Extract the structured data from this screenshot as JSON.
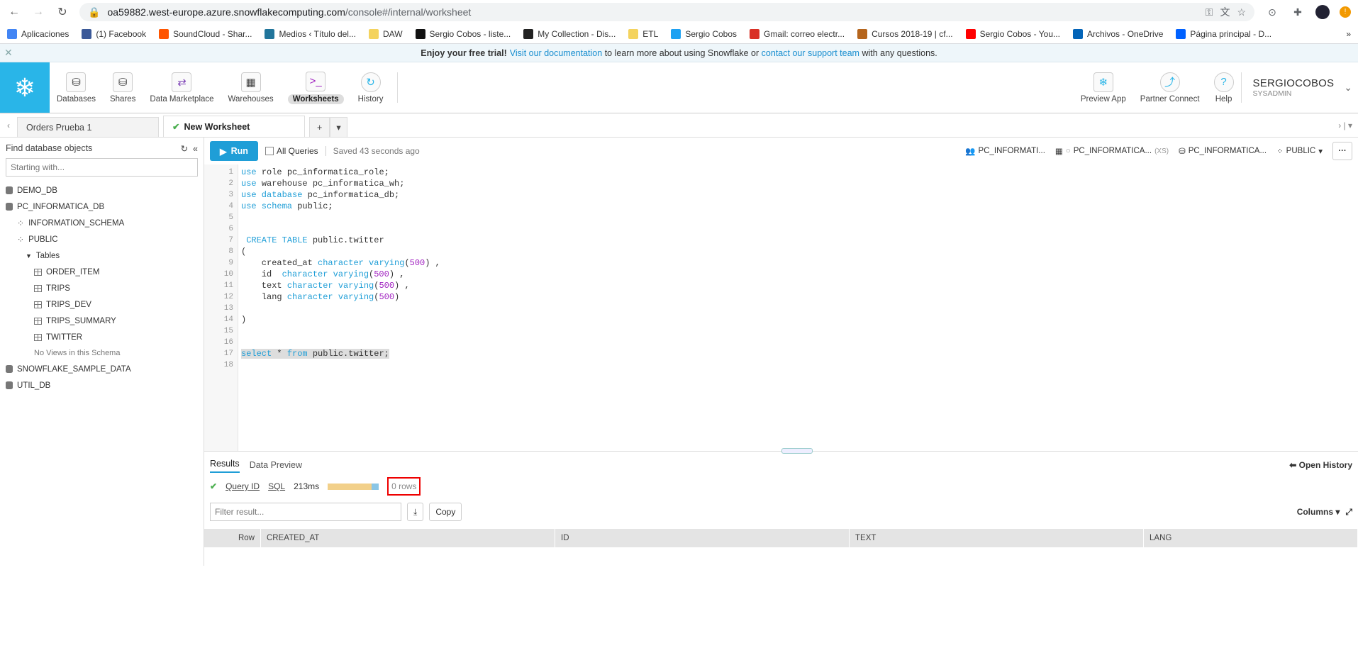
{
  "browser": {
    "url_host": "oa59882.west-europe.azure.snowflakecomputing.com",
    "url_path": "/console#/internal/worksheet"
  },
  "bookmarks": [
    {
      "label": "Aplicaciones",
      "color": "#4285f4"
    },
    {
      "label": "(1) Facebook",
      "color": "#3b5998"
    },
    {
      "label": "SoundCloud - Shar...",
      "color": "#ff5500"
    },
    {
      "label": "Medios ‹ Título del...",
      "color": "#21759b"
    },
    {
      "label": "DAW",
      "color": "#f4d35e"
    },
    {
      "label": "Sergio Cobos - liste...",
      "color": "#111111"
    },
    {
      "label": "My Collection - Dis...",
      "color": "#222222"
    },
    {
      "label": "ETL",
      "color": "#f4d35e"
    },
    {
      "label": "Sergio Cobos",
      "color": "#1da1f2"
    },
    {
      "label": "Gmail: correo electr...",
      "color": "#d93025"
    },
    {
      "label": "Cursos 2018-19 | cf...",
      "color": "#b5651d"
    },
    {
      "label": "Sergio Cobos - You...",
      "color": "#ff0000"
    },
    {
      "label": "Archivos - OneDrive",
      "color": "#0364b8"
    },
    {
      "label": "Página principal - D...",
      "color": "#0061ff"
    }
  ],
  "trial": {
    "bold": "Enjoy your free trial!",
    "link1": "Visit our documentation",
    "mid": "to learn more about using Snowflake or",
    "link2": "contact our support team",
    "end": "with any questions."
  },
  "nav": {
    "items": [
      "Databases",
      "Shares",
      "Data Marketplace",
      "Warehouses",
      "Worksheets",
      "History"
    ],
    "right": [
      "Preview App",
      "Partner Connect",
      "Help"
    ],
    "user": "SERGIOCOBOS",
    "role": "SYSADMIN"
  },
  "tabs": [
    "Orders Prueba 1",
    "New Worksheet"
  ],
  "sidebar": {
    "title": "Find database objects",
    "placeholder": "Starting with...",
    "dbs": [
      "DEMO_DB",
      "PC_INFORMATICA_DB",
      "SNOWFLAKE_SAMPLE_DATA",
      "UTIL_DB"
    ],
    "schemas": [
      "INFORMATION_SCHEMA",
      "PUBLIC"
    ],
    "tables_label": "Tables",
    "tables": [
      "ORDER_ITEM",
      "TRIPS",
      "TRIPS_DEV",
      "TRIPS_SUMMARY",
      "TWITTER"
    ],
    "no_views": "No Views in this Schema"
  },
  "toolbar": {
    "run": "Run",
    "all_queries": "All Queries",
    "saved": "Saved 43 seconds ago"
  },
  "context": {
    "role": "PC_INFORMATI...",
    "warehouse": "PC_INFORMATICA...",
    "wh_size": "(XS)",
    "database": "PC_INFORMATICA...",
    "schema": "PUBLIC"
  },
  "results": {
    "tab_results": "Results",
    "tab_preview": "Data Preview",
    "open_history": "Open History",
    "query_id": "Query ID",
    "sql": "SQL",
    "duration": "213ms",
    "rows": "0 rows",
    "filter_placeholder": "Filter result...",
    "copy": "Copy",
    "columns": "Columns",
    "headers": [
      "Row",
      "CREATED_AT",
      "ID",
      "TEXT",
      "LANG"
    ]
  }
}
